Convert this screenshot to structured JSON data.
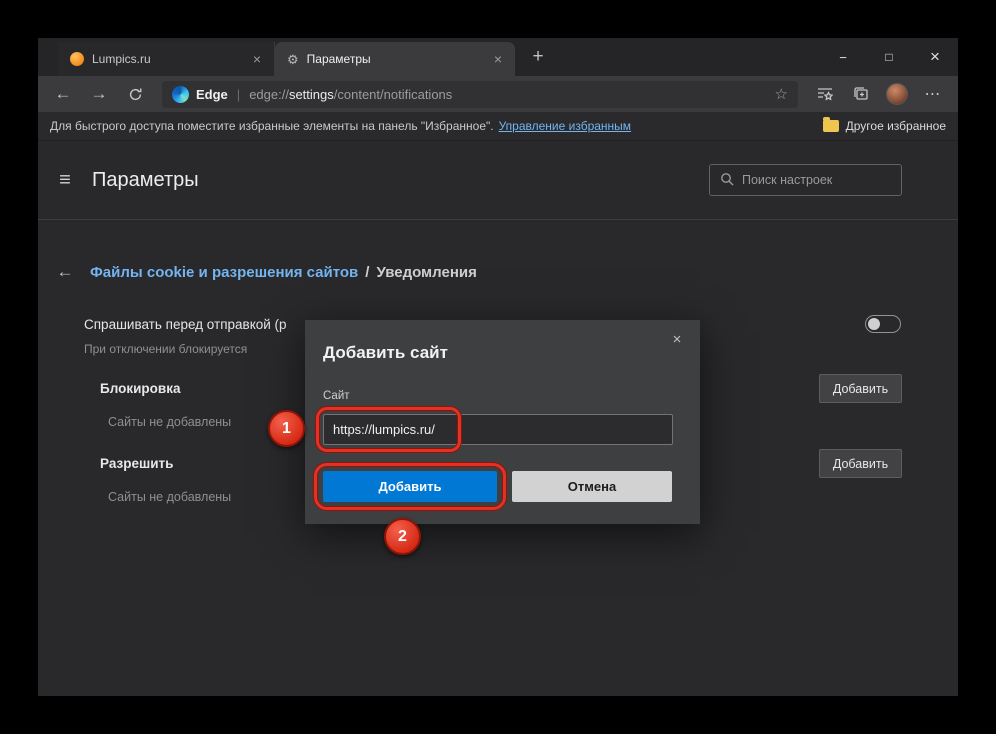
{
  "window": {
    "tabs": [
      {
        "label": "Lumpics.ru"
      },
      {
        "label": "Параметры"
      }
    ],
    "controls": {
      "minimize": "−",
      "maximize": "□",
      "close": "×"
    }
  },
  "icons": {
    "gear": "⚙",
    "back": "←",
    "forward": "→",
    "star": "☆",
    "menu": "≡",
    "more": "⋯",
    "new_tab": "+",
    "tab_close": "×",
    "dialog_close": "×",
    "breadcrumb_back": "←"
  },
  "toolbar": {
    "edge_label": "Edge",
    "divider": "|",
    "url_scheme": "edge://",
    "url_host": "settings",
    "url_path": "/content/notifications"
  },
  "favorites_bar": {
    "notice": "Для быстрого доступа поместите избранные элементы на панель \"Избранное\".",
    "manage_link": "Управление избранным",
    "other_favorites": "Другое избранное"
  },
  "settings": {
    "title": "Параметры",
    "search_placeholder": "Поиск настроек",
    "breadcrumb_section": "Файлы cookie и разрешения сайтов",
    "breadcrumb_separator": "/",
    "breadcrumb_page": "Уведомления",
    "ask_label": "Спрашивать перед отправкой (р",
    "ask_sublabel": "При отключении блокируется",
    "block_heading": "Блокировка",
    "block_empty": "Сайты не добавлены",
    "allow_heading": "Разрешить",
    "allow_empty": "Сайты не добавлены",
    "add_button": "Добавить"
  },
  "dialog": {
    "title": "Добавить сайт",
    "field_label": "Сайт",
    "field_value": "https://lumpics.ru/",
    "primary_button": "Добавить",
    "secondary_button": "Отмена"
  },
  "annotations": {
    "step1": "1",
    "step2": "2"
  },
  "colors": {
    "accent": "#0078d4",
    "link": "#74b4f0",
    "annotation": "#e03325"
  }
}
